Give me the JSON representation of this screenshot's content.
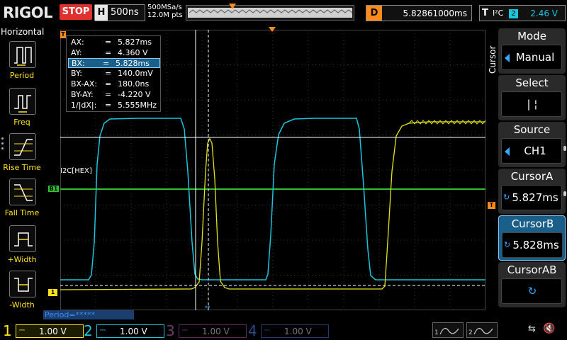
{
  "header": {
    "brand": "RIGOL",
    "run_state": "STOP",
    "timebase_key": "H",
    "timebase_value": "500ns",
    "sample_rate": "500MSa/s",
    "memory_depth": "12.0M pts",
    "delay_key": "D",
    "delay_value": "5.82861000ms",
    "trigger_key": "T",
    "trigger_type": "I²C",
    "trigger_source": "2",
    "trigger_level": "2.46 V"
  },
  "left_panel": {
    "title": "Horizontal",
    "items": [
      {
        "label": "Period",
        "icon": "period-icon"
      },
      {
        "label": "Freq",
        "icon": "frequency-icon"
      },
      {
        "label": "Rise Time",
        "icon": "rise-time-icon"
      },
      {
        "label": "Fall Time",
        "icon": "fall-time-icon"
      },
      {
        "label": "+Width",
        "icon": "positive-width-icon"
      },
      {
        "label": "-Width",
        "icon": "negative-width-icon"
      }
    ]
  },
  "cursor_readout": {
    "rows": [
      {
        "key": "AX:",
        "value": "5.827ms"
      },
      {
        "key": "AY:",
        "value": "4.360 V"
      },
      {
        "key": "BX:",
        "value": "5.828ms"
      },
      {
        "key": "BY:",
        "value": "140.0mV"
      },
      {
        "key": "BX-AX:",
        "value": "180.0ns"
      },
      {
        "key": "BY-AY:",
        "value": "-4.220 V"
      },
      {
        "key": "1/|dX|:",
        "value": "5.555MHz"
      }
    ],
    "eq": "="
  },
  "waveform": {
    "bus_label": "I2C[HEX]",
    "bus_marker": "B1",
    "ch1_marker": "1",
    "trigger_marker": "T",
    "ch1_color": "#e6e21c",
    "ch2_color": "#19c6dc",
    "bus_color": "#2fbf2f",
    "cursor_color": "#ffffff",
    "trigger_color": "#ff8c1a"
  },
  "right_menu": {
    "title": "Cursor",
    "items": [
      {
        "title": "Mode",
        "value": "Manual"
      },
      {
        "title": "Select",
        "value": "|   ¦"
      },
      {
        "title": "Source",
        "value": "CH1"
      },
      {
        "title": "CursorA",
        "value": "5.827ms"
      },
      {
        "title": "CursorB",
        "value": "5.828ms"
      },
      {
        "title": "CursorAB",
        "value": "↻"
      }
    ]
  },
  "footer": {
    "period_text": "Period=*****",
    "channels": [
      {
        "num": "1",
        "coupling": "⎓",
        "scale": "1.00 V",
        "color": "#ffe11c"
      },
      {
        "num": "2",
        "coupling": "⎓",
        "scale": "1.00 V",
        "color": "#19c6dc"
      },
      {
        "num": "3",
        "coupling": "⎓",
        "scale": "1.00 V",
        "color": "#c040c0"
      },
      {
        "num": "4",
        "coupling": "⎓",
        "scale": "1.00 V",
        "color": "#3a7cff"
      }
    ],
    "usb_icon": "⇆",
    "speaker_icon": "🔇"
  }
}
